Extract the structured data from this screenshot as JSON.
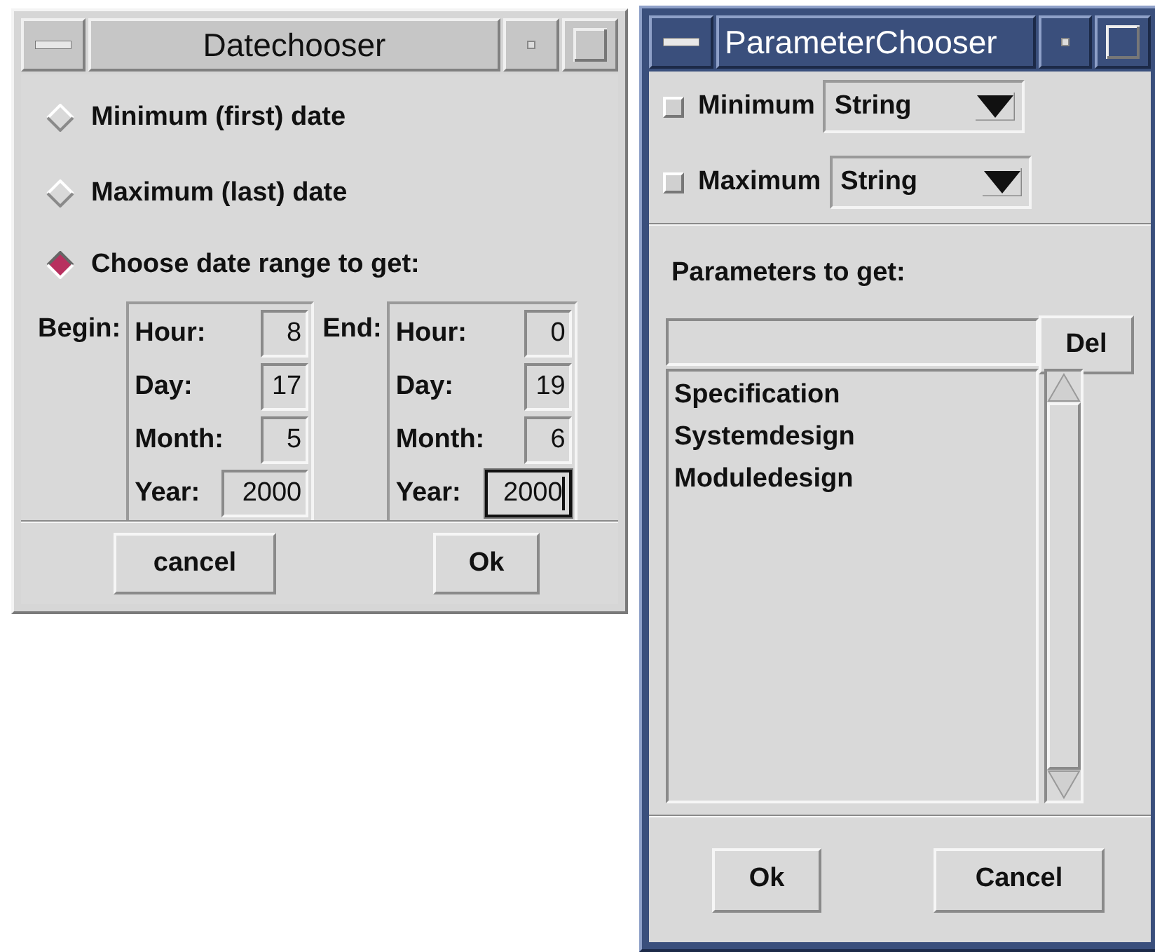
{
  "date_chooser": {
    "title": "Datechooser",
    "options": [
      {
        "label": "Minimum (first) date",
        "selected": false
      },
      {
        "label": "Maximum (last) date",
        "selected": false
      },
      {
        "label": "Choose date range to get:",
        "selected": true
      }
    ],
    "ranges": [
      {
        "label": "Begin:",
        "fields": [
          {
            "label": "Hour:",
            "value": "8",
            "focused": false
          },
          {
            "label": "Day:",
            "value": "17",
            "focused": false
          },
          {
            "label": "Month:",
            "value": "5",
            "focused": false
          },
          {
            "label": "Year:",
            "value": "2000",
            "focused": false
          }
        ]
      },
      {
        "label": "End:",
        "fields": [
          {
            "label": "Hour:",
            "value": "0",
            "focused": false
          },
          {
            "label": "Day:",
            "value": "19",
            "focused": false
          },
          {
            "label": "Month:",
            "value": "6",
            "focused": false
          },
          {
            "label": "Year:",
            "value": "2000",
            "focused": true
          }
        ]
      }
    ],
    "buttons": [
      "cancel",
      "Ok"
    ]
  },
  "parameter_chooser": {
    "title": "ParameterChooser",
    "limits": [
      {
        "label": "Minimum",
        "checked": false,
        "type": "String"
      },
      {
        "label": "Maximum",
        "checked": false,
        "type": "String"
      }
    ],
    "parameters_label": "Parameters to get:",
    "delete_button": "Del",
    "parameters": [
      "Specification",
      "Systemdesign",
      "Moduledesign"
    ],
    "buttons": [
      "Ok",
      "Cancel"
    ]
  }
}
